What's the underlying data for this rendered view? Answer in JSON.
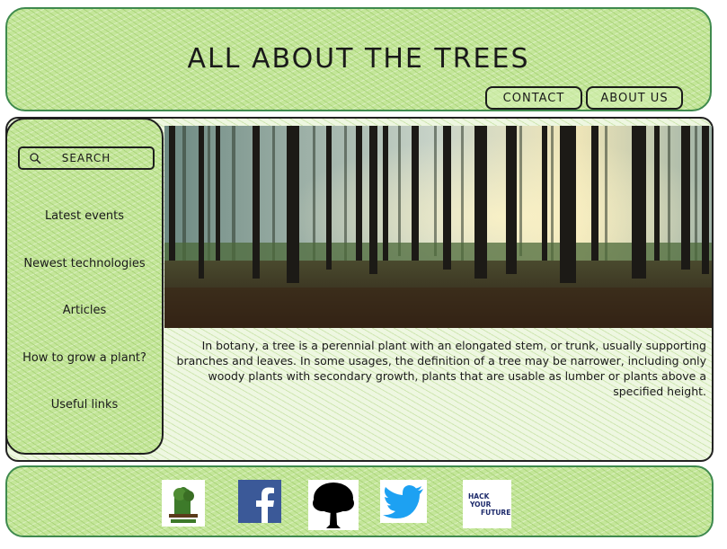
{
  "header": {
    "title": "ALL ABOUT THE TREES",
    "nav": [
      {
        "label": "CONTACT"
      },
      {
        "label": "ABOUT US"
      }
    ]
  },
  "sidebar": {
    "search_label": "SEARCH",
    "items": [
      {
        "label": "Latest events"
      },
      {
        "label": "Newest technologies"
      },
      {
        "label": "Articles"
      },
      {
        "label": "How to grow a plant?"
      },
      {
        "label": "Useful links"
      }
    ]
  },
  "main": {
    "hero_image": "forest-photo",
    "intro": "In botany, a tree is a perennial plant with an elongated stem, or trunk, usually supporting branches and leaves. In some usages, the definition of a tree may be narrower, including only woody plants with secondary growth, plants that are  usable as lumber or plants above a specified height."
  },
  "footer": {
    "links": [
      {
        "icon": "green-logo"
      },
      {
        "icon": "facebook-icon"
      },
      {
        "icon": "tree-icon"
      },
      {
        "icon": "twitter-icon"
      },
      {
        "icon": "hyf-logo"
      }
    ],
    "hyf_lines": [
      "HACK",
      "YOUR",
      "FUTURE"
    ]
  },
  "colors": {
    "panel_green": "#c4e69a",
    "border_green": "#3f8a4e",
    "facebook_blue": "#3b5998",
    "twitter_blue": "#1da1f2"
  }
}
